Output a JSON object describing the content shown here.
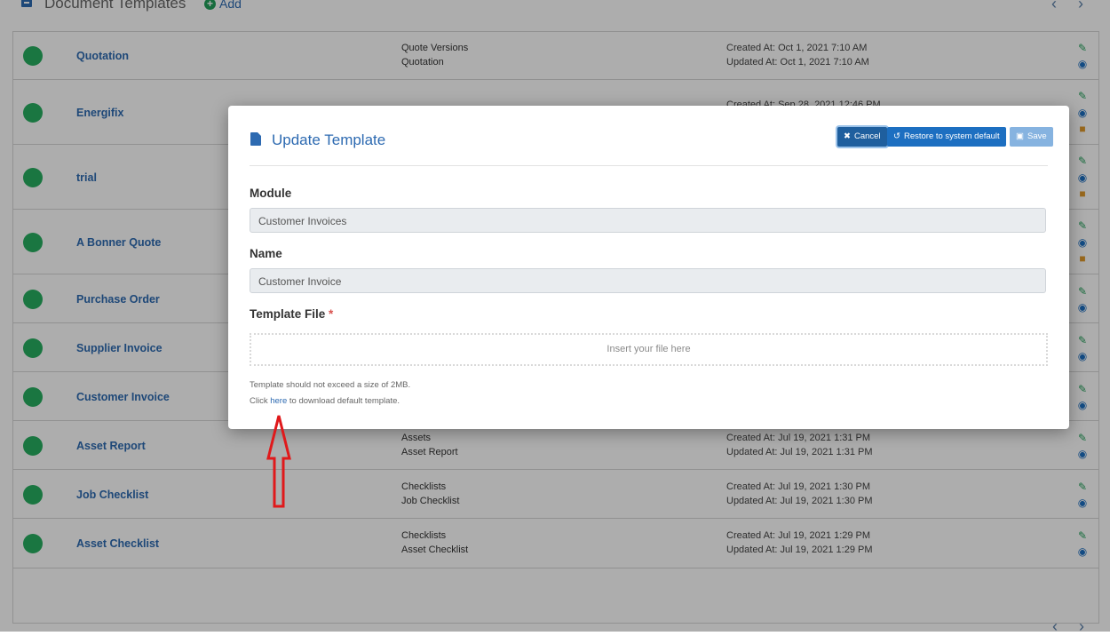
{
  "header": {
    "title": "Document Templates",
    "add_label": "Add"
  },
  "pager": {
    "prev": "‹",
    "next": "›"
  },
  "rows": [
    {
      "name": "Quotation",
      "module": "Quote Versions",
      "template": "Quotation",
      "created": "Created At: Oct 1, 2021 7:10 AM",
      "updated": "Updated At: Oct 1, 2021 7:10 AM"
    },
    {
      "name": "Energifix",
      "module": "",
      "template": "",
      "created": "Created At: Sep 28, 2021 12:46 PM",
      "updated": ""
    },
    {
      "name": "trial",
      "module": "",
      "template": "",
      "created": "",
      "updated": ""
    },
    {
      "name": "A Bonner Quote",
      "module": "",
      "template": "",
      "created": "",
      "updated": ""
    },
    {
      "name": "Purchase Order",
      "module": "",
      "template": "",
      "created": "",
      "updated": ""
    },
    {
      "name": "Supplier Invoice",
      "module": "",
      "template": "",
      "created": "",
      "updated": ""
    },
    {
      "name": "Customer Invoice",
      "module": "",
      "template": "",
      "created": "",
      "updated": ""
    },
    {
      "name": "Asset Report",
      "module": "Assets",
      "template": "Asset Report",
      "created": "Created At: Jul 19, 2021 1:31 PM",
      "updated": "Updated At: Jul 19, 2021 1:31 PM"
    },
    {
      "name": "Job Checklist",
      "module": "Checklists",
      "template": "Job Checklist",
      "created": "Created At: Jul 19, 2021 1:30 PM",
      "updated": "Updated At: Jul 19, 2021 1:30 PM"
    },
    {
      "name": "Asset Checklist",
      "module": "Checklists",
      "template": "Asset Checklist",
      "created": "Created At: Jul 19, 2021 1:29 PM",
      "updated": "Updated At: Jul 19, 2021 1:29 PM"
    }
  ],
  "modal": {
    "title": "Update Template",
    "cancel_label": "Cancel",
    "restore_label": "Restore to system default",
    "save_label": "Save",
    "module_label": "Module",
    "module_value": "Customer Invoices",
    "name_label": "Name",
    "name_value": "Customer Invoice",
    "file_label": "Template File",
    "required_mark": "*",
    "dropzone_text": "Insert your file here",
    "size_hint": "Template should not exceed a size of 2MB.",
    "download_prefix": "Click",
    "download_link": "here",
    "download_suffix": "to download default template."
  },
  "colors": {
    "accent": "#2d6ab1",
    "status": "#27ae60",
    "annotation_arrow": "#e0191b"
  }
}
